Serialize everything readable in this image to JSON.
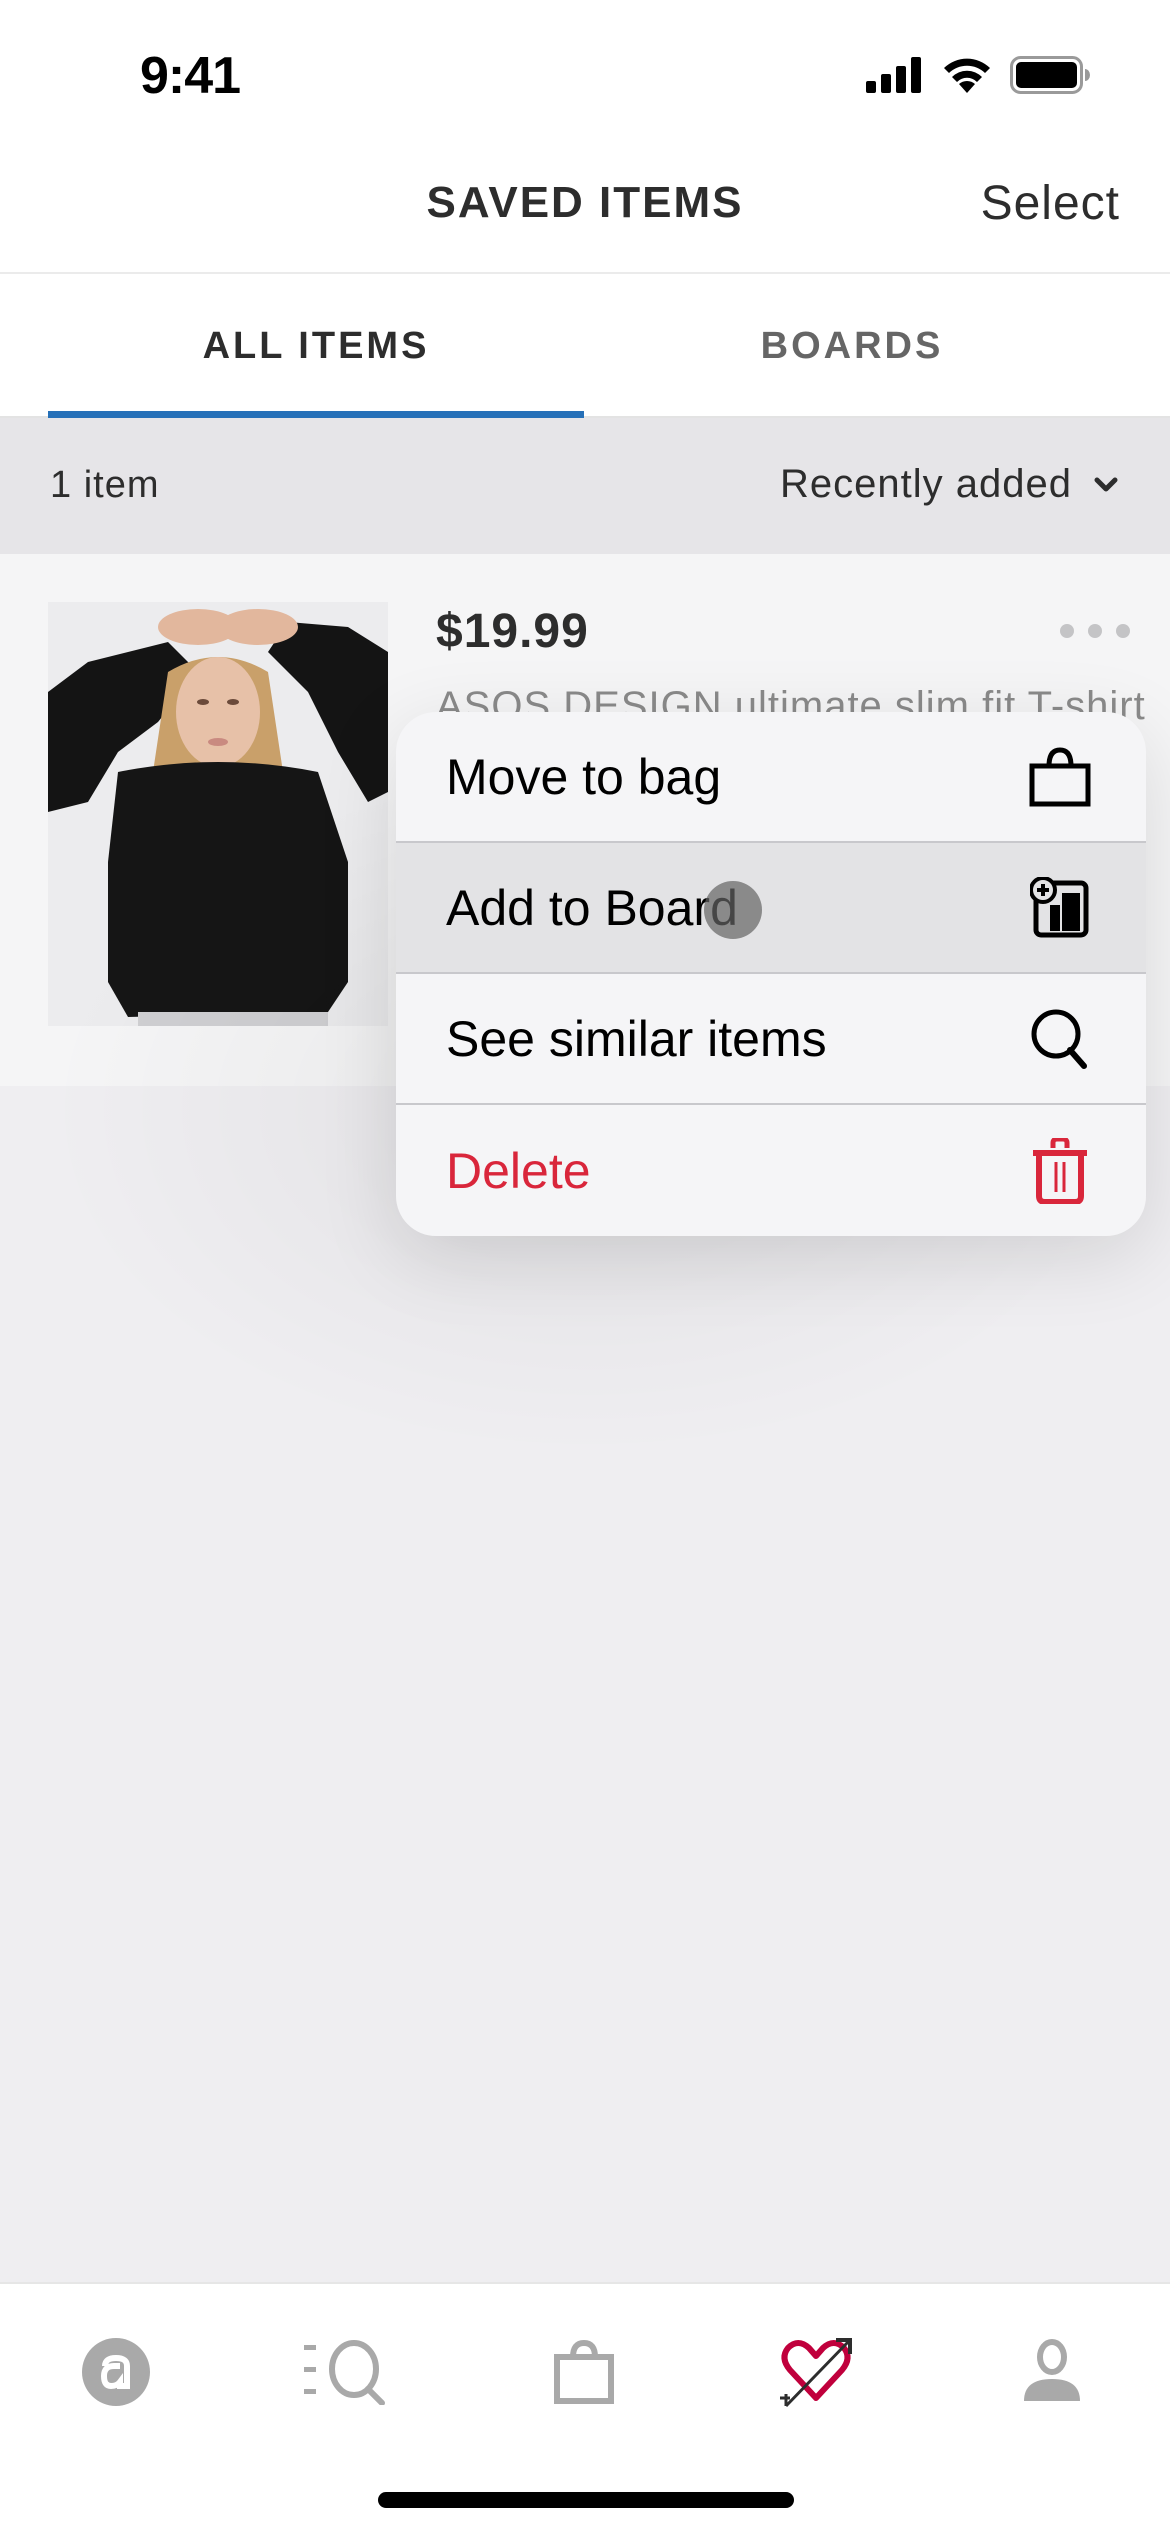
{
  "status_bar": {
    "time": "9:41"
  },
  "header": {
    "title": "SAVED ITEMS",
    "select_label": "Select"
  },
  "tabs": [
    {
      "label": "ALL ITEMS",
      "active": true
    },
    {
      "label": "BOARDS",
      "active": false
    }
  ],
  "sort_bar": {
    "item_count": "1 item",
    "sort_value": "Recently added"
  },
  "product": {
    "price": "$19.99",
    "name": "ASOS DESIGN ultimate slim fit T-shirt",
    "image_alt": "Woman wearing black long sleeve T-shirt"
  },
  "context_menu": {
    "items": [
      {
        "label": "Move to bag",
        "icon": "shopping-bag-icon",
        "highlighted": false,
        "destructive": false
      },
      {
        "label": "Add to Board",
        "icon": "add-to-board-icon",
        "highlighted": true,
        "destructive": false
      },
      {
        "label": "See similar items",
        "icon": "search-icon",
        "highlighted": false,
        "destructive": false
      },
      {
        "label": "Delete",
        "icon": "trash-icon",
        "highlighted": false,
        "destructive": true
      }
    ]
  },
  "bottom_nav": {
    "items": [
      {
        "name": "home",
        "icon": "asos-logo-icon",
        "active": false
      },
      {
        "name": "search",
        "icon": "search-list-icon",
        "active": false
      },
      {
        "name": "bag",
        "icon": "bag-icon",
        "active": false
      },
      {
        "name": "saved",
        "icon": "heart-arrow-icon",
        "active": true
      },
      {
        "name": "account",
        "icon": "account-icon",
        "active": false
      }
    ]
  },
  "colors": {
    "accent": "#2670b8",
    "destructive": "#d9263b",
    "saved_active": "#c0003c",
    "nav_inactive": "#a9a9a9"
  }
}
